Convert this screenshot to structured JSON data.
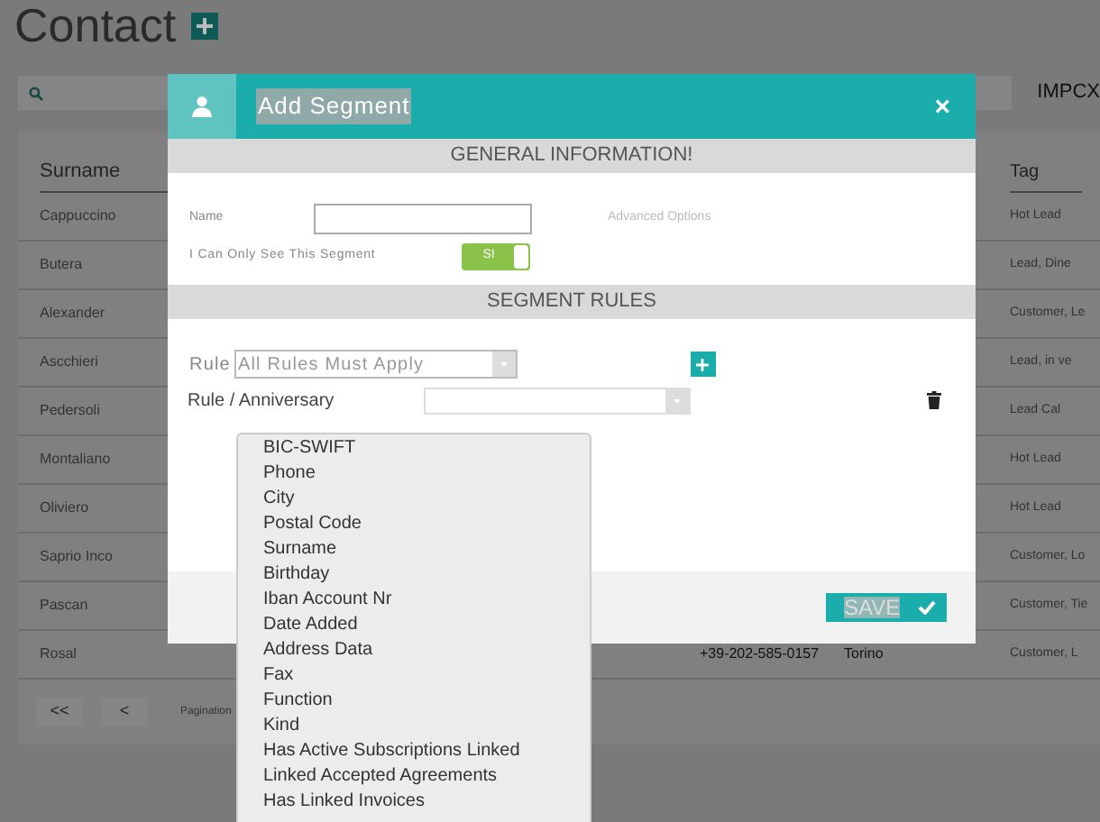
{
  "page": {
    "title": "Contact",
    "account": "IMPCX"
  },
  "table": {
    "columns": [
      "Surname",
      "Tag"
    ],
    "rows": [
      {
        "surname": "Cappuccino",
        "tag": "Hot Lead"
      },
      {
        "surname": "Butera",
        "tag": "Lead, Dine"
      },
      {
        "surname": "Alexander",
        "tag": "Customer, Le"
      },
      {
        "surname": "Ascchieri",
        "tag": "Lead, in ve"
      },
      {
        "surname": "Pedersoli",
        "tag": "Lead Cal"
      },
      {
        "surname": "Montaliano",
        "tag": "Hot Lead"
      },
      {
        "surname": "Oliviero",
        "tag": "Hot Lead"
      },
      {
        "surname": "Saprio Inco",
        "tag": "Customer, Lo"
      },
      {
        "surname": "Pascan",
        "tag": "Customer, Tie"
      },
      {
        "surname": "Rosal",
        "phone": "+39-202-585-0157",
        "city": "Torino",
        "tag": "Customer, L"
      }
    ]
  },
  "pagination": {
    "buttons": [
      "<<",
      "<"
    ],
    "label": "Pagination"
  },
  "modal": {
    "title": "Add Segment",
    "close": "×",
    "general_header": "GENERAL INFORMATION!",
    "name_label": "Name",
    "advanced_label": "Advanced Options",
    "private_label": "I Can Only See This Segment",
    "private_toggle": {
      "label": "SI",
      "on": true
    },
    "rules_header": "SEGMENT RULES",
    "rule_mode": {
      "label": "Rule",
      "value": "All Rules Must Apply"
    },
    "rule": {
      "label": "Rule / Anniversary"
    },
    "save": "SAVE"
  },
  "dropdown": {
    "options": [
      {
        "label": "BIC-SWIFT"
      },
      {
        "label": "Phone"
      },
      {
        "label": "City"
      },
      {
        "label": "Postal Code"
      },
      {
        "label": "Surname"
      },
      {
        "label": "Birthday"
      },
      {
        "label": "Iban Account Nr"
      },
      {
        "label": "Date Added"
      },
      {
        "label": "Address Data"
      },
      {
        "label": "Fax"
      },
      {
        "label": "Function"
      },
      {
        "label": "Kind"
      },
      {
        "label": "Has Active Subscriptions Linked"
      },
      {
        "label": "Linked Accepted Agreements"
      },
      {
        "label": "Has Linked Invoices"
      }
    ]
  }
}
